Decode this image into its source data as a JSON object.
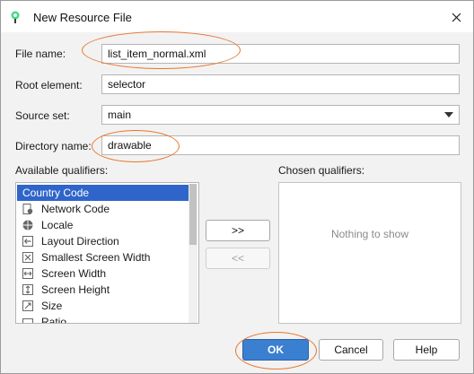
{
  "window": {
    "title": "New Resource File"
  },
  "form": {
    "file_name_label": "File name:",
    "file_name_value": "list_item_normal.xml",
    "root_element_label": "Root element:",
    "root_element_value": "selector",
    "source_set_label": "Source set:",
    "source_set_value": "main",
    "directory_name_label": "Directory name:",
    "directory_name_value": "drawable"
  },
  "qualifiers": {
    "available_label": "Available qualifiers:",
    "chosen_label": "Chosen qualifiers:",
    "items": [
      {
        "label": "Country Code",
        "icon": "country-code-icon",
        "selected": true
      },
      {
        "label": "Network Code",
        "icon": "network-code-icon"
      },
      {
        "label": "Locale",
        "icon": "globe-icon"
      },
      {
        "label": "Layout Direction",
        "icon": "layout-direction-icon"
      },
      {
        "label": "Smallest Screen Width",
        "icon": "smallest-width-icon"
      },
      {
        "label": "Screen Width",
        "icon": "screen-width-icon"
      },
      {
        "label": "Screen Height",
        "icon": "screen-height-icon"
      },
      {
        "label": "Size",
        "icon": "size-icon"
      },
      {
        "label": "Ratio",
        "icon": "ratio-icon"
      }
    ],
    "add_label": ">>",
    "remove_label": "<<",
    "empty_text": "Nothing to show"
  },
  "buttons": {
    "ok": "OK",
    "cancel": "Cancel",
    "help": "Help"
  },
  "colors": {
    "selection": "#2f65ca",
    "primary_button": "#3b7fd1",
    "annotation": "#e8762d"
  }
}
